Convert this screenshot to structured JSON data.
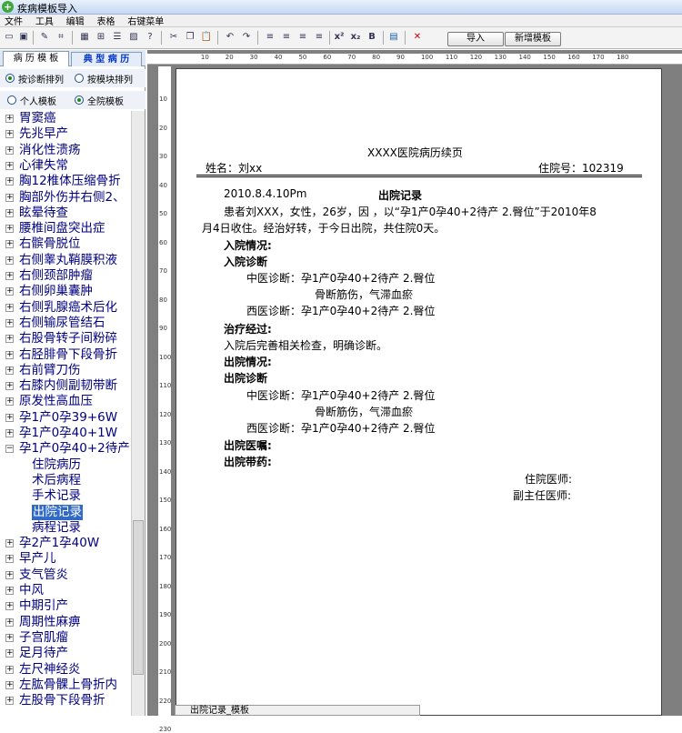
{
  "window": {
    "title": "疾病模板导入"
  },
  "menu": [
    "文件",
    "工具",
    "编辑",
    "表格",
    "右键菜单"
  ],
  "toolbar": {
    "import_label": "导入",
    "new_template_label": "新增模板"
  },
  "panel": {
    "tab_records": "病 历 模 板",
    "tab_typical": "典 型 病 历",
    "sort_by_diagnosis": "按诊断排列",
    "sort_by_module": "按模块排列",
    "personal_template": "个人模板",
    "all_template": "全院模板"
  },
  "tree": [
    "胃窦癌",
    "先兆早产",
    "消化性溃疡",
    "心律失常",
    "胸12椎体压缩骨折",
    "胸部外伤并右侧2、",
    "眩晕待查",
    "腰椎间盘突出症",
    "右髌骨脱位",
    "右侧睾丸鞘膜积液",
    "右侧颈部肿瘤",
    "右侧卵巢囊肿",
    "右侧乳腺癌术后化",
    "右侧输尿管结石",
    "右股骨转子间粉碎",
    "右胫腓骨下段骨折",
    "右前臂刀伤",
    "右膝内侧副韧带断",
    "原发性高血压",
    "孕1产0孕39+6W",
    "孕1产0孕40+1W",
    "孕1产0孕40+2待产"
  ],
  "tree_children": [
    "住院病历",
    "术后病程",
    "手术记录",
    "出院记录",
    "病程记录"
  ],
  "tree_after": [
    "孕2产1孕40W",
    "早产儿",
    "支气管炎",
    "中风",
    "中期引产",
    "周期性麻痹",
    "子宫肌瘤",
    "足月待产",
    "左尺神经炎",
    "左肱骨髁上骨折内",
    "左股骨下段骨折"
  ],
  "hruler_ticks": [
    "10",
    "20",
    "30",
    "40",
    "50",
    "60",
    "70",
    "80",
    "90",
    "100",
    "110",
    "120",
    "130",
    "140",
    "150",
    "160",
    "170",
    "180"
  ],
  "vruler_ticks": [
    "10",
    "20",
    "30",
    "40",
    "50",
    "60",
    "70",
    "80",
    "90",
    "100",
    "110",
    "120",
    "130",
    "140",
    "150",
    "160",
    "170",
    "180",
    "190",
    "200",
    "210",
    "220",
    "230"
  ],
  "doc": {
    "header_title": "XXXX医院病历续页",
    "name_label": "姓名：刘xx",
    "inpatient_no": "住院号：102319",
    "date": "2010.8.4.10Pm",
    "title": "出院记录",
    "para1a": "患者刘XXX，女性，26岁，因      ，以“孕1产0孕40+2待产 2.臀位”于2010年8",
    "para1b": "月4日收住。经治好转，于今日出院，共住院0天。",
    "admission_status": "入院情况:",
    "admission_diagnosis": "入院诊断",
    "tcm_dx": "中医诊断：孕1产0孕40+2待产 2.臀位",
    "tcm_dx2": "骨断筋伤，气滞血瘀",
    "wm_dx": "西医诊断：孕1产0孕40+2待产 2.臀位",
    "treatment": "治疗经过:",
    "treatment_text": "入院后完善相关检查，明确诊断。",
    "discharge_status": "出院情况:",
    "discharge_diagnosis": "出院诊断",
    "tcm_dx_out": "中医诊断：孕1产0孕40+2待产 2.臀位",
    "tcm_dx_out2": "骨断筋伤，气滞血瘀",
    "wm_dx_out": "西医诊断：孕1产0孕40+2待产 2.臀位",
    "discharge_orders": "出院医嘱:",
    "discharge_meds": "出院带药:",
    "resident": "住院医师:",
    "associate_chief": "副主任医师:"
  },
  "bottom_tab": "出院记录_模板"
}
